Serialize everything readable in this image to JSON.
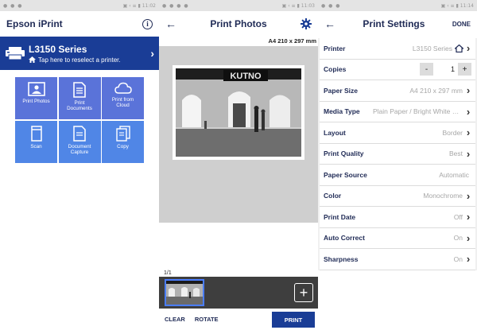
{
  "screen1": {
    "status_left": "● ● ●",
    "status_right": "▣ ‹ ≡ ▮ 11:02",
    "title": "Epson iPrint",
    "info_icon": "info-icon",
    "printer_name": "L3150 Series",
    "printer_hint": "Tap here to reselect a printer.",
    "tiles": [
      {
        "label": "Print Photos",
        "icon": "photo-icon"
      },
      {
        "label": "Print Documents",
        "icon": "document-icon"
      },
      {
        "label": "Print from Cloud",
        "icon": "cloud-icon"
      },
      {
        "label": "Scan",
        "icon": "scan-icon"
      },
      {
        "label": "Document Capture",
        "icon": "document-capture-icon"
      },
      {
        "label": "Copy",
        "icon": "copy-icon"
      }
    ],
    "colors": {
      "banner": "#1a3d96",
      "tile": "#5a73d9",
      "tile_bottom": "#5086e6"
    }
  },
  "screen2": {
    "status_left": "● ● ● ●",
    "status_right": "▣ ‹ ≡ ▮ 11:03",
    "title": "Print Photos",
    "paper_size": "A4 210 x 297 mm",
    "photo_sign": "KUTNO",
    "page_count": "1/1",
    "clear_label": "CLEAR",
    "rotate_label": "ROTATE",
    "print_label": "PRINT"
  },
  "screen3": {
    "status_left": "● ● ●",
    "status_right": "▣ ‹ ≡ ▮ 11:14",
    "title": "Print Settings",
    "done_label": "DONE",
    "printer_label": "Printer",
    "printer_value": "L3150 Series",
    "copies_label": "Copies",
    "copies_value": "1",
    "copies_minus": "-",
    "copies_plus": "+",
    "rows": [
      {
        "label": "Paper Size",
        "value": "A4 210 x 297 mm",
        "arrow": true
      },
      {
        "label": "Media Type",
        "value": "Plain Paper / Bright White Paper",
        "arrow": true
      },
      {
        "label": "Layout",
        "value": "Border",
        "arrow": true
      },
      {
        "label": "Print Quality",
        "value": "Best",
        "arrow": true
      },
      {
        "label": "Paper Source",
        "value": "Automatic",
        "arrow": false
      },
      {
        "label": "Color",
        "value": "Monochrome",
        "arrow": true
      },
      {
        "label": "Print Date",
        "value": "Off",
        "arrow": true
      },
      {
        "label": "Auto Correct",
        "value": "On",
        "arrow": true
      },
      {
        "label": "Sharpness",
        "value": "On",
        "arrow": true
      }
    ]
  }
}
